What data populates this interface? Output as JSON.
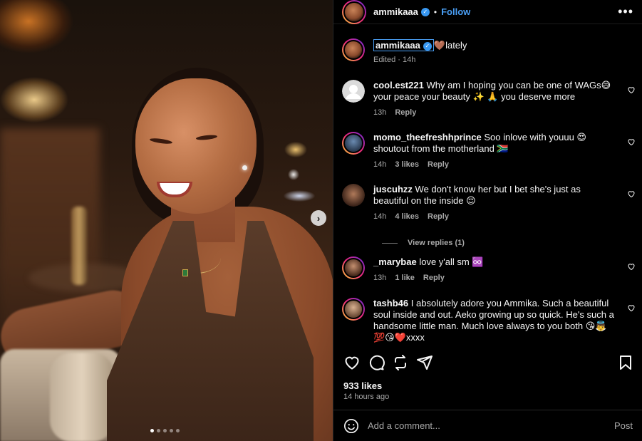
{
  "post": {
    "author": "ammikaaa",
    "follow_label": "Follow",
    "separator": "•",
    "more_label": "•••",
    "caption_text": "🤎lately",
    "caption_meta": "Edited · 14h",
    "carousel": {
      "slides": 5,
      "active_index": 0
    },
    "next_label": "›"
  },
  "comments": [
    {
      "user": "cool.est221",
      "text": "Why am I hoping you can be one of WAGs😅 your peace your beauty ✨ 🙏 you deserve more",
      "time": "13h",
      "likes": "",
      "reply": "Reply",
      "avatar": "default-avatar"
    },
    {
      "user": "momo_theefreshhprince",
      "text": "Soo inlove with youuu 😍shoutout from the motherland 🇿🇦",
      "time": "14h",
      "likes": "3 likes",
      "reply": "Reply",
      "avatar": "photo-avatar"
    },
    {
      "user": "juscuhzz",
      "text": "We don't know her but I bet she's just as beautiful on the inside 😌",
      "time": "14h",
      "likes": "4 likes",
      "reply": "Reply",
      "avatar": "photo-avatar"
    },
    {
      "user": "_marybae",
      "text": "love y'all sm ♾️",
      "time": "13h",
      "likes": "1 like",
      "reply": "Reply",
      "avatar": "photo-avatar"
    },
    {
      "user": "tashb46",
      "text": "I absolutely adore you Ammika. Such a beautiful soul inside and out. Aeko growing up so quick. He's such a handsome little man. Much love always to you both 😘👼💯😘❤️xxxx",
      "time": "",
      "likes": "",
      "reply": "",
      "avatar": "photo-avatar"
    }
  ],
  "view_replies": "View replies (1)",
  "likes_count": "933 likes",
  "timestamp": "14 hours ago",
  "add_comment": {
    "placeholder": "Add a comment...",
    "post_label": "Post"
  },
  "icons": [
    "heart-icon",
    "comment-icon",
    "repost-icon",
    "share-icon",
    "bookmark-icon",
    "emoji-icon",
    "verified-icon",
    "chevron-right-icon"
  ],
  "colors": {
    "background": "#000000",
    "accent": "#4a9ff5",
    "verified": "#3897f0",
    "muted": "#a8a8a8"
  }
}
